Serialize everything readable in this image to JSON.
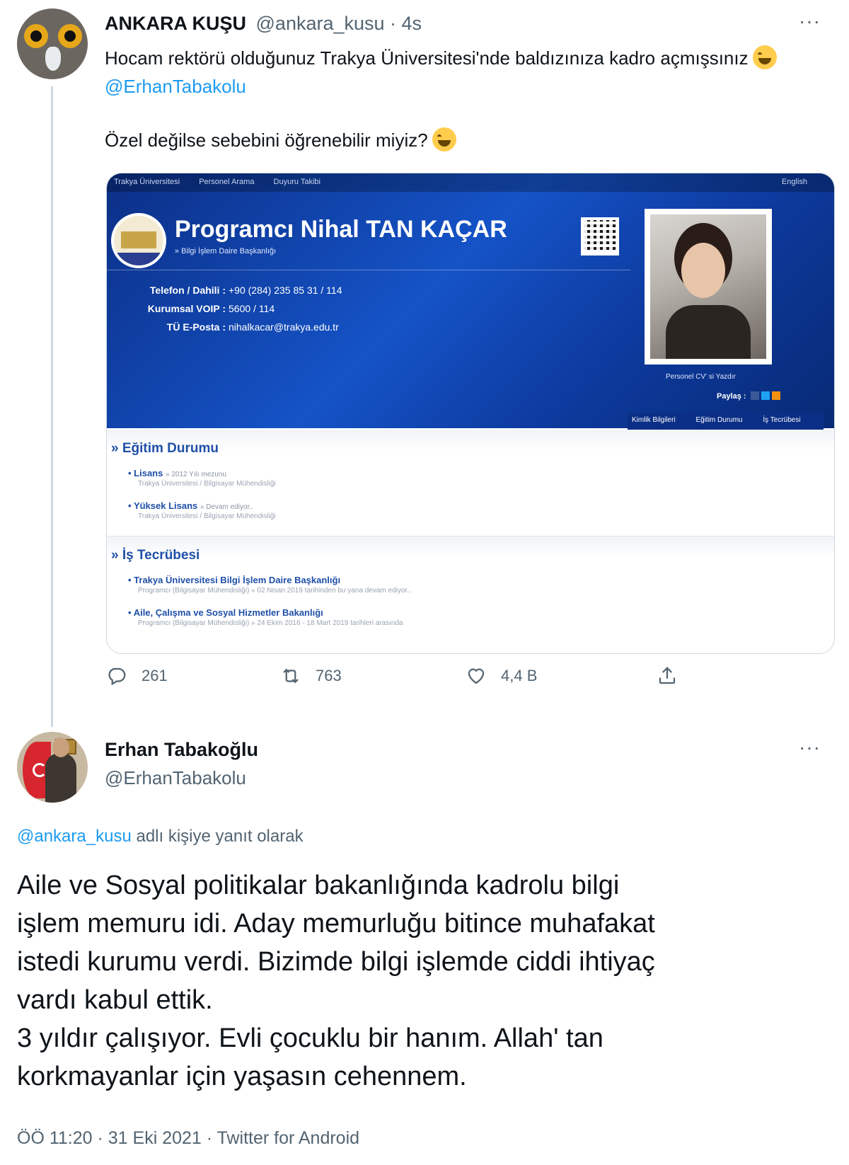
{
  "tweet1": {
    "author_name": "ANKARA KUŞU",
    "author_handle": "@ankara_kusu",
    "separator": " · ",
    "time_ago": "4s",
    "more_label": "···",
    "text_line1": "Hocam rektörü olduğunuz Trakya Üniversitesi'nde baldızınıza kadro açmışsınız",
    "mention": "@ErhanTabakolu",
    "text_line2": "Özel değilse sebebini öğrenebilir miyiz?",
    "counts": {
      "replies": "261",
      "retweets": "763",
      "likes": "4,4 B"
    }
  },
  "embedded_image": {
    "nav_items": [
      "Trakya Üniversitesi",
      "Personel Arama",
      "Duyuru Takibi"
    ],
    "lang": "English",
    "title": "Programcı Nihal TAN KAÇAR",
    "subtitle": "» Bilgi İşlem Daire Başkanlığı",
    "contact": [
      {
        "label": "Telefon / Dahili :",
        "value": "+90 (284) 235 85 31 / 114"
      },
      {
        "label": "Kurumsal VOIP :",
        "value": "5600 / 114"
      },
      {
        "label": "TÜ E-Posta :",
        "value": "nihalkacar@trakya.edu.tr"
      }
    ],
    "photo_caption": "Personel CV' si Yazdır",
    "share_label": "Paylaş :",
    "tabs": [
      "Kimlik Bilgileri",
      "Eğitim Durumu",
      "İş Tecrübesi"
    ],
    "education_title": "» Eğitim Durumu",
    "education": [
      {
        "title": "Lisans",
        "note": "» 2012 Yılı mezunu",
        "detail": "Trakya Üniversitesi / Bilgisayar Mühendisliği"
      },
      {
        "title": "Yüksek Lisans",
        "note": "» Devam ediyor..",
        "detail": "Trakya Üniversitesi / Bilgisayar Mühendisliği"
      }
    ],
    "experience_title": "» İş Tecrübesi",
    "experience": [
      {
        "title": "Trakya Üniversitesi Bilgi İşlem Daire Başkanlığı",
        "detail": "Programcı (Bilgisayar Mühendisliği) » 02 Nisan 2019 tarihinden bu yana devam ediyor.."
      },
      {
        "title": "Aile, Çalışma ve Sosyal Hizmetler Bakanlığı",
        "detail": "Programcı (Bilgisayar Mühendisliği) » 24 Ekim 2016 - 18 Mart 2019 tarihleri arasında"
      }
    ]
  },
  "tweet2": {
    "author_name": "Erhan Tabakoğlu",
    "author_handle": "@ErhanTabakolu",
    "more_label": "···",
    "replying_mention": "@ankara_kusu",
    "replying_text": " adlı kişiye yanıt olarak",
    "body_lines": [
      "Aile ve Sosyal politikalar bakanlığında kadrolu bilgi",
      "işlem memuru idi. Aday memurluğu bitince muhafakat",
      "istedi kurumu verdi. Bizimde bilgi işlemde ciddi ihtiyaç",
      "vardı kabul ettik.",
      "3 yıldır çalışıyor. Evli çocuklu bir hanım. Allah' tan",
      "korkmayanlar için yaşasın cehennem."
    ],
    "meta": "ÖÖ 11:20 · 31 Eki 2021 · Twitter for Android"
  },
  "colors": {
    "link": "#1d9bf0",
    "secondary_text": "#536471",
    "primary_text": "#0f1419",
    "thread_line": "#cfd9de",
    "hero_blue": "#1553c7"
  },
  "icons": {
    "reply": "reply-icon",
    "retweet": "retweet-icon",
    "like": "heart-icon",
    "share": "share-icon",
    "more": "more-icon"
  }
}
